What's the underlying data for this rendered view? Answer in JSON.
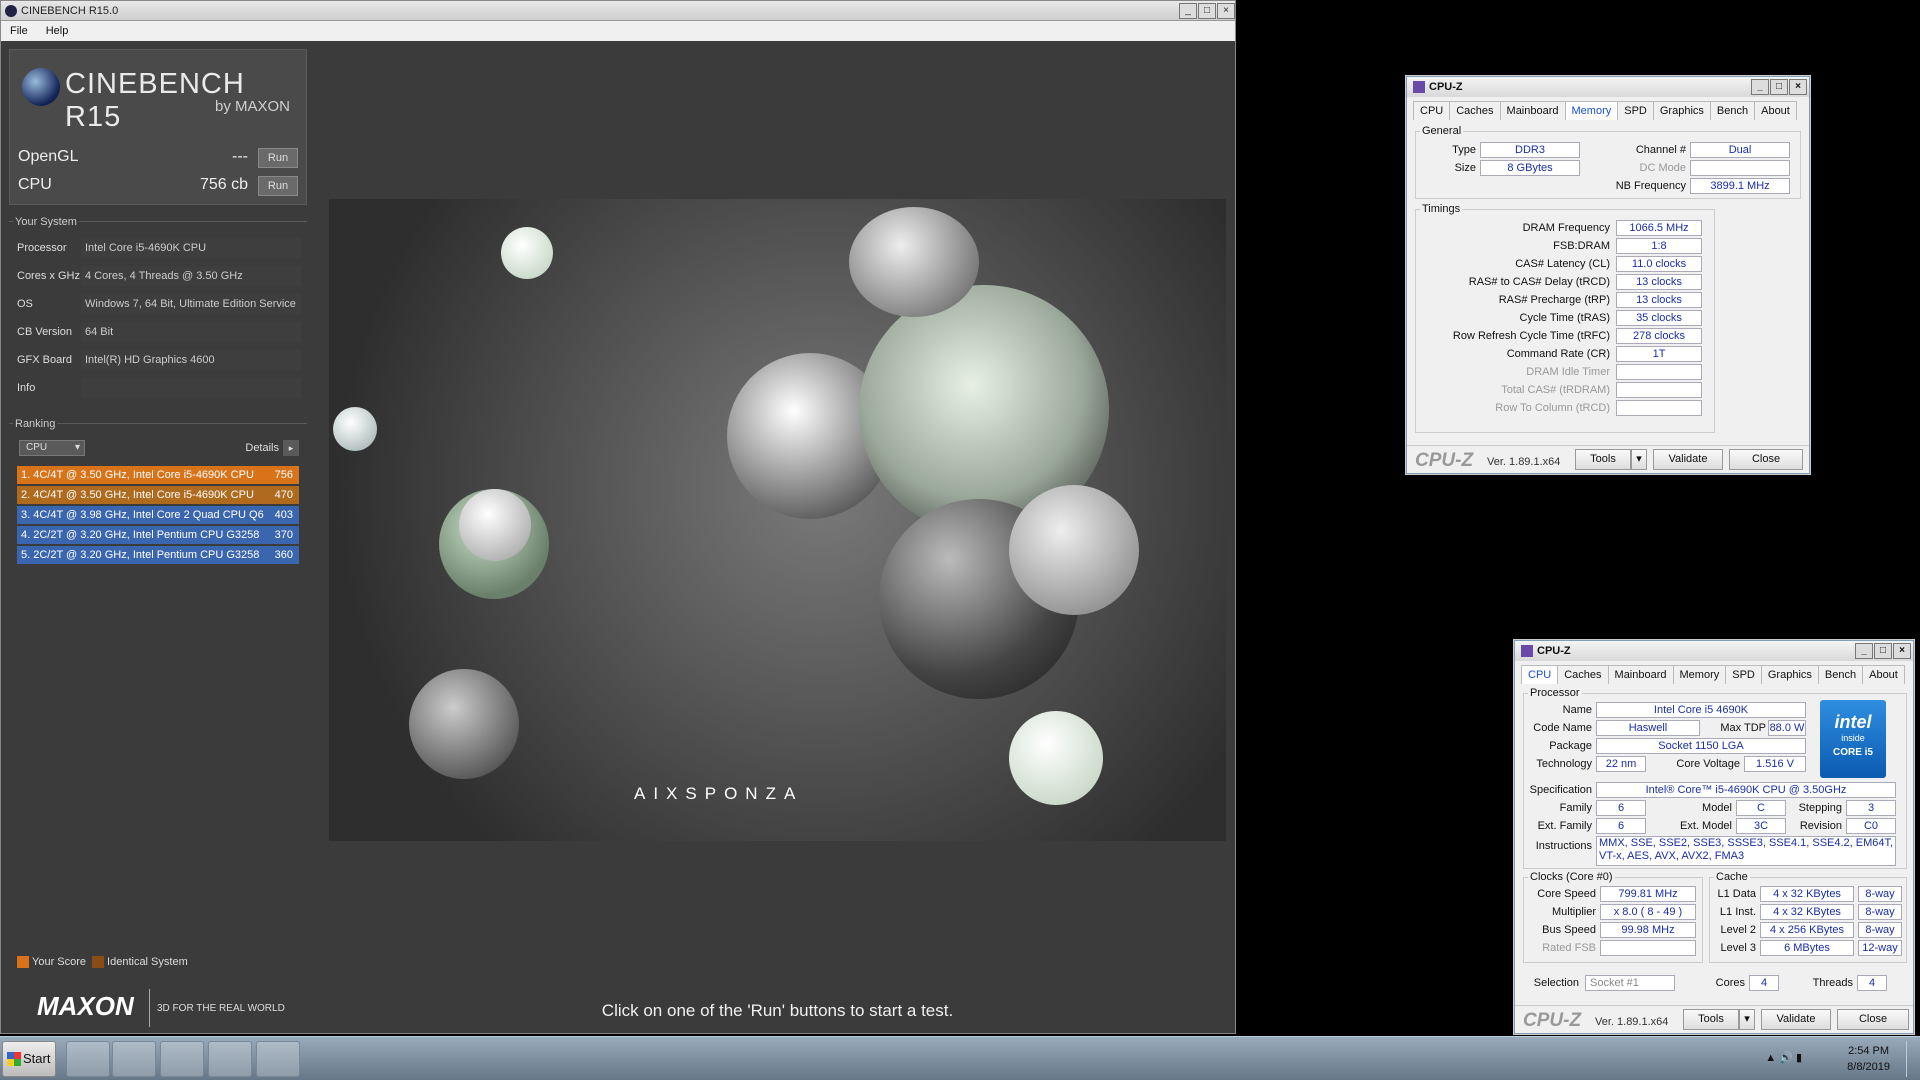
{
  "cinebench": {
    "title": "CINEBENCH R15.0",
    "menu": [
      "File",
      "Help"
    ],
    "logo_title": "CINEBENCH R15",
    "logo_by": "by MAXON",
    "opengl": {
      "label": "OpenGL",
      "value": "---",
      "run": "Run"
    },
    "cpu": {
      "label": "CPU",
      "value": "756 cb",
      "run": "Run"
    },
    "your_system": {
      "heading": "Your System",
      "rows": [
        {
          "k": "Processor",
          "v": "Intel Core i5-4690K CPU"
        },
        {
          "k": "Cores x GHz",
          "v": "4 Cores, 4 Threads @ 3.50 GHz"
        },
        {
          "k": "OS",
          "v": "Windows 7, 64 Bit, Ultimate Edition Service"
        },
        {
          "k": "CB Version",
          "v": "64 Bit"
        },
        {
          "k": "GFX Board",
          "v": "Intel(R) HD Graphics 4600"
        },
        {
          "k": "Info",
          "v": ""
        }
      ]
    },
    "ranking": {
      "heading": "Ranking",
      "dropdown": "CPU",
      "details": "Details",
      "items": [
        {
          "label": "1. 4C/4T @ 3.50 GHz, Intel Core i5-4690K CPU",
          "score": "756",
          "color": "#d9731a"
        },
        {
          "label": "2. 4C/4T @ 3.50 GHz, Intel Core i5-4690K CPU",
          "score": "470",
          "color": "#b06a1e"
        },
        {
          "label": "3. 4C/4T @ 3.98 GHz, Intel Core 2 Quad CPU Q6",
          "score": "403",
          "color": "#3a66b0"
        },
        {
          "label": "4. 2C/2T @ 3.20 GHz, Intel Pentium CPU G3258",
          "score": "370",
          "color": "#3a66b0"
        },
        {
          "label": "5. 2C/2T @ 3.20 GHz, Intel Pentium CPU G3258",
          "score": "360",
          "color": "#3a66b0"
        }
      ],
      "legend_your": "Your Score",
      "legend_identical": "Identical System"
    },
    "maxon": "MAXON",
    "maxon_tag": "3D FOR THE REAL WORLD",
    "render_brand": "AIXSPONZA",
    "status": "Click on one of the 'Run' buttons to start a test."
  },
  "cpuz_memory": {
    "title": "CPU-Z",
    "tabs": [
      "CPU",
      "Caches",
      "Mainboard",
      "Memory",
      "SPD",
      "Graphics",
      "Bench",
      "About"
    ],
    "active_tab": "Memory",
    "general": "General",
    "type_label": "Type",
    "type": "DDR3",
    "size_label": "Size",
    "size": "8 GBytes",
    "channel_label": "Channel #",
    "channel": "Dual",
    "dcmode_label": "DC Mode",
    "dcmode": "",
    "nbfreq_label": "NB Frequency",
    "nbfreq": "3899.1 MHz",
    "timings": "Timings",
    "timing_rows": [
      {
        "k": "DRAM Frequency",
        "v": "1066.5 MHz",
        "dim": false
      },
      {
        "k": "FSB:DRAM",
        "v": "1:8",
        "dim": false
      },
      {
        "k": "CAS# Latency (CL)",
        "v": "11.0 clocks",
        "dim": false
      },
      {
        "k": "RAS# to CAS# Delay (tRCD)",
        "v": "13 clocks",
        "dim": false
      },
      {
        "k": "RAS# Precharge (tRP)",
        "v": "13 clocks",
        "dim": false
      },
      {
        "k": "Cycle Time (tRAS)",
        "v": "35 clocks",
        "dim": false
      },
      {
        "k": "Row Refresh Cycle Time (tRFC)",
        "v": "278 clocks",
        "dim": false
      },
      {
        "k": "Command Rate (CR)",
        "v": "1T",
        "dim": false
      },
      {
        "k": "DRAM Idle Timer",
        "v": "",
        "dim": true
      },
      {
        "k": "Total CAS# (tRDRAM)",
        "v": "",
        "dim": true
      },
      {
        "k": "Row To Column (tRCD)",
        "v": "",
        "dim": true
      }
    ],
    "logo": "CPU-Z",
    "version": "Ver. 1.89.1.x64",
    "tools": "Tools",
    "validate": "Validate",
    "close": "Close"
  },
  "cpuz_cpu": {
    "title": "CPU-Z",
    "tabs": [
      "CPU",
      "Caches",
      "Mainboard",
      "Memory",
      "SPD",
      "Graphics",
      "Bench",
      "About"
    ],
    "active_tab": "CPU",
    "processor": "Processor",
    "name_label": "Name",
    "name": "Intel Core i5 4690K",
    "codename_label": "Code Name",
    "codename": "Haswell",
    "maxtdp_label": "Max TDP",
    "maxtdp": "88.0 W",
    "package_label": "Package",
    "package": "Socket 1150 LGA",
    "tech_label": "Technology",
    "tech": "22 nm",
    "voltage_label": "Core Voltage",
    "voltage": "1.516 V",
    "spec_label": "Specification",
    "spec": "Intel® Core™ i5-4690K CPU @ 3.50GHz",
    "family_label": "Family",
    "family": "6",
    "model_label": "Model",
    "model": "C",
    "stepping_label": "Stepping",
    "stepping": "3",
    "extfamily_label": "Ext. Family",
    "extfamily": "6",
    "extmodel_label": "Ext. Model",
    "extmodel": "3C",
    "revision_label": "Revision",
    "revision": "C0",
    "instr_label": "Instructions",
    "instr": "MMX, SSE, SSE2, SSE3, SSSE3, SSE4.1, SSE4.2, EM64T, VT-x, AES, AVX, AVX2, FMA3",
    "intel_badge": "intel",
    "intel_inside": "inside",
    "intel_core": "CORE i5",
    "clocks": "Clocks (Core #0)",
    "corespeed_label": "Core Speed",
    "corespeed": "799.81 MHz",
    "multiplier_label": "Multiplier",
    "multiplier": "x 8.0 ( 8 - 49 )",
    "busspeed_label": "Bus Speed",
    "busspeed": "99.98 MHz",
    "ratedfsb_label": "Rated FSB",
    "ratedfsb": "",
    "cache": "Cache",
    "l1d_label": "L1 Data",
    "l1d": "4 x 32 KBytes",
    "l1d_way": "8-way",
    "l1i_label": "L1 Inst.",
    "l1i": "4 x 32 KBytes",
    "l1i_way": "8-way",
    "l2_label": "Level 2",
    "l2": "4 x 256 KBytes",
    "l2_way": "8-way",
    "l3_label": "Level 3",
    "l3": "6 MBytes",
    "l3_way": "12-way",
    "selection_label": "Selection",
    "selection": "Socket #1",
    "cores_label": "Cores",
    "cores": "4",
    "threads_label": "Threads",
    "threads": "4",
    "logo": "CPU-Z",
    "version": "Ver. 1.89.1.x64",
    "tools": "Tools",
    "validate": "Validate",
    "close": "Close"
  },
  "taskbar": {
    "start": "Start",
    "time": "2:54 PM",
    "date": "8/8/2019"
  }
}
